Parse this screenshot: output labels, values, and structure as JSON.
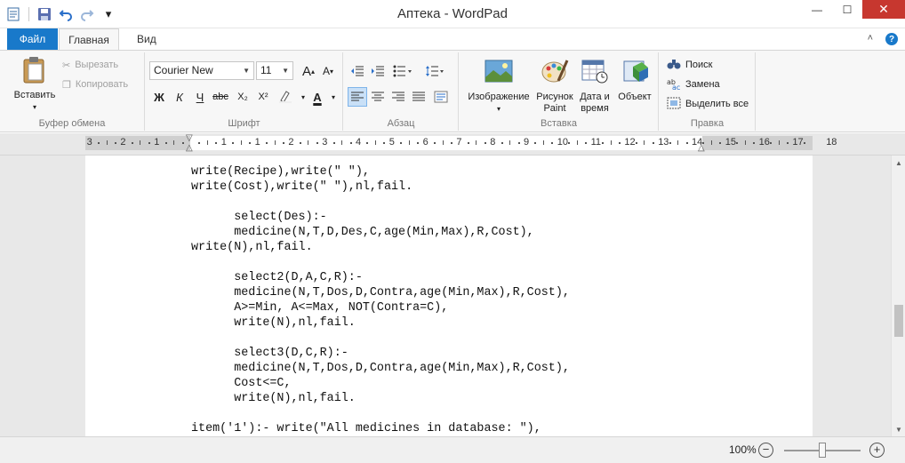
{
  "window": {
    "title": "Аптека - WordPad",
    "minimize": "—",
    "maximize": "☐",
    "close": "✕"
  },
  "quick_access": {
    "app_icon": "wordpad-icon",
    "save_icon": "save-icon",
    "undo_icon": "undo-icon",
    "redo_icon": "redo-icon",
    "customize": "▾"
  },
  "tabs": {
    "file": "Файл",
    "home": "Главная",
    "view": "Вид",
    "collapse": "˄",
    "help": "?"
  },
  "clipboard": {
    "paste_label": "Вставить",
    "cut_label": "Вырезать",
    "copy_label": "Копировать",
    "group_label": "Буфер обмена"
  },
  "font": {
    "family": "Courier New",
    "size": "11",
    "grow": "A",
    "shrink": "A",
    "bold": "Ж",
    "italic": "К",
    "underline": "Ч",
    "strike": "abc",
    "subscript": "X₂",
    "superscript": "X²",
    "text_color": "A",
    "group_label": "Шрифт"
  },
  "paragraph": {
    "group_label": "Абзац"
  },
  "insert": {
    "image_label": "Изображение",
    "paint_label": "Рисунок Paint",
    "paint_line1": "Рисунок",
    "paint_line2": "Paint",
    "datetime_line1": "Дата и",
    "datetime_line2": "время",
    "object_label": "Объект",
    "group_label": "Вставка"
  },
  "editing": {
    "find_label": "Поиск",
    "replace_label": "Замена",
    "select_all_label": "Выделить все",
    "group_label": "Правка"
  },
  "ruler": {
    "numbers": [
      "3",
      "2",
      "1",
      "1",
      "1",
      "2",
      "3",
      "4",
      "5",
      "6",
      "7",
      "8",
      "9",
      "10",
      "11",
      "12",
      "13",
      "14",
      "15",
      "16",
      "17",
      "18"
    ]
  },
  "document": {
    "lines": [
      "write(Recipe),write(\" \"),",
      "write(Cost),write(\" \"),nl,fail.",
      "",
      "      select(Des):-",
      "      medicine(N,T,D,Des,C,age(Min,Max),R,Cost),",
      "write(N),nl,fail.",
      "",
      "      select2(D,A,C,R):-",
      "      medicine(N,T,Dos,D,Contra,age(Min,Max),R,Cost),",
      "      A>=Min, A<=Max, NOT(Contra=C),",
      "      write(N),nl,fail.",
      "",
      "      select3(D,C,R):-",
      "      medicine(N,T,Dos,D,Contra,age(Min,Max),R,Cost),",
      "      Cost<=C,",
      "      write(N),nl,fail.",
      "",
      "item('1'):- write(\"All medicines in database: \"),"
    ]
  },
  "status": {
    "zoom": "100%",
    "zoom_out": "−",
    "zoom_in": "+",
    "zoom_level": 1.0
  }
}
